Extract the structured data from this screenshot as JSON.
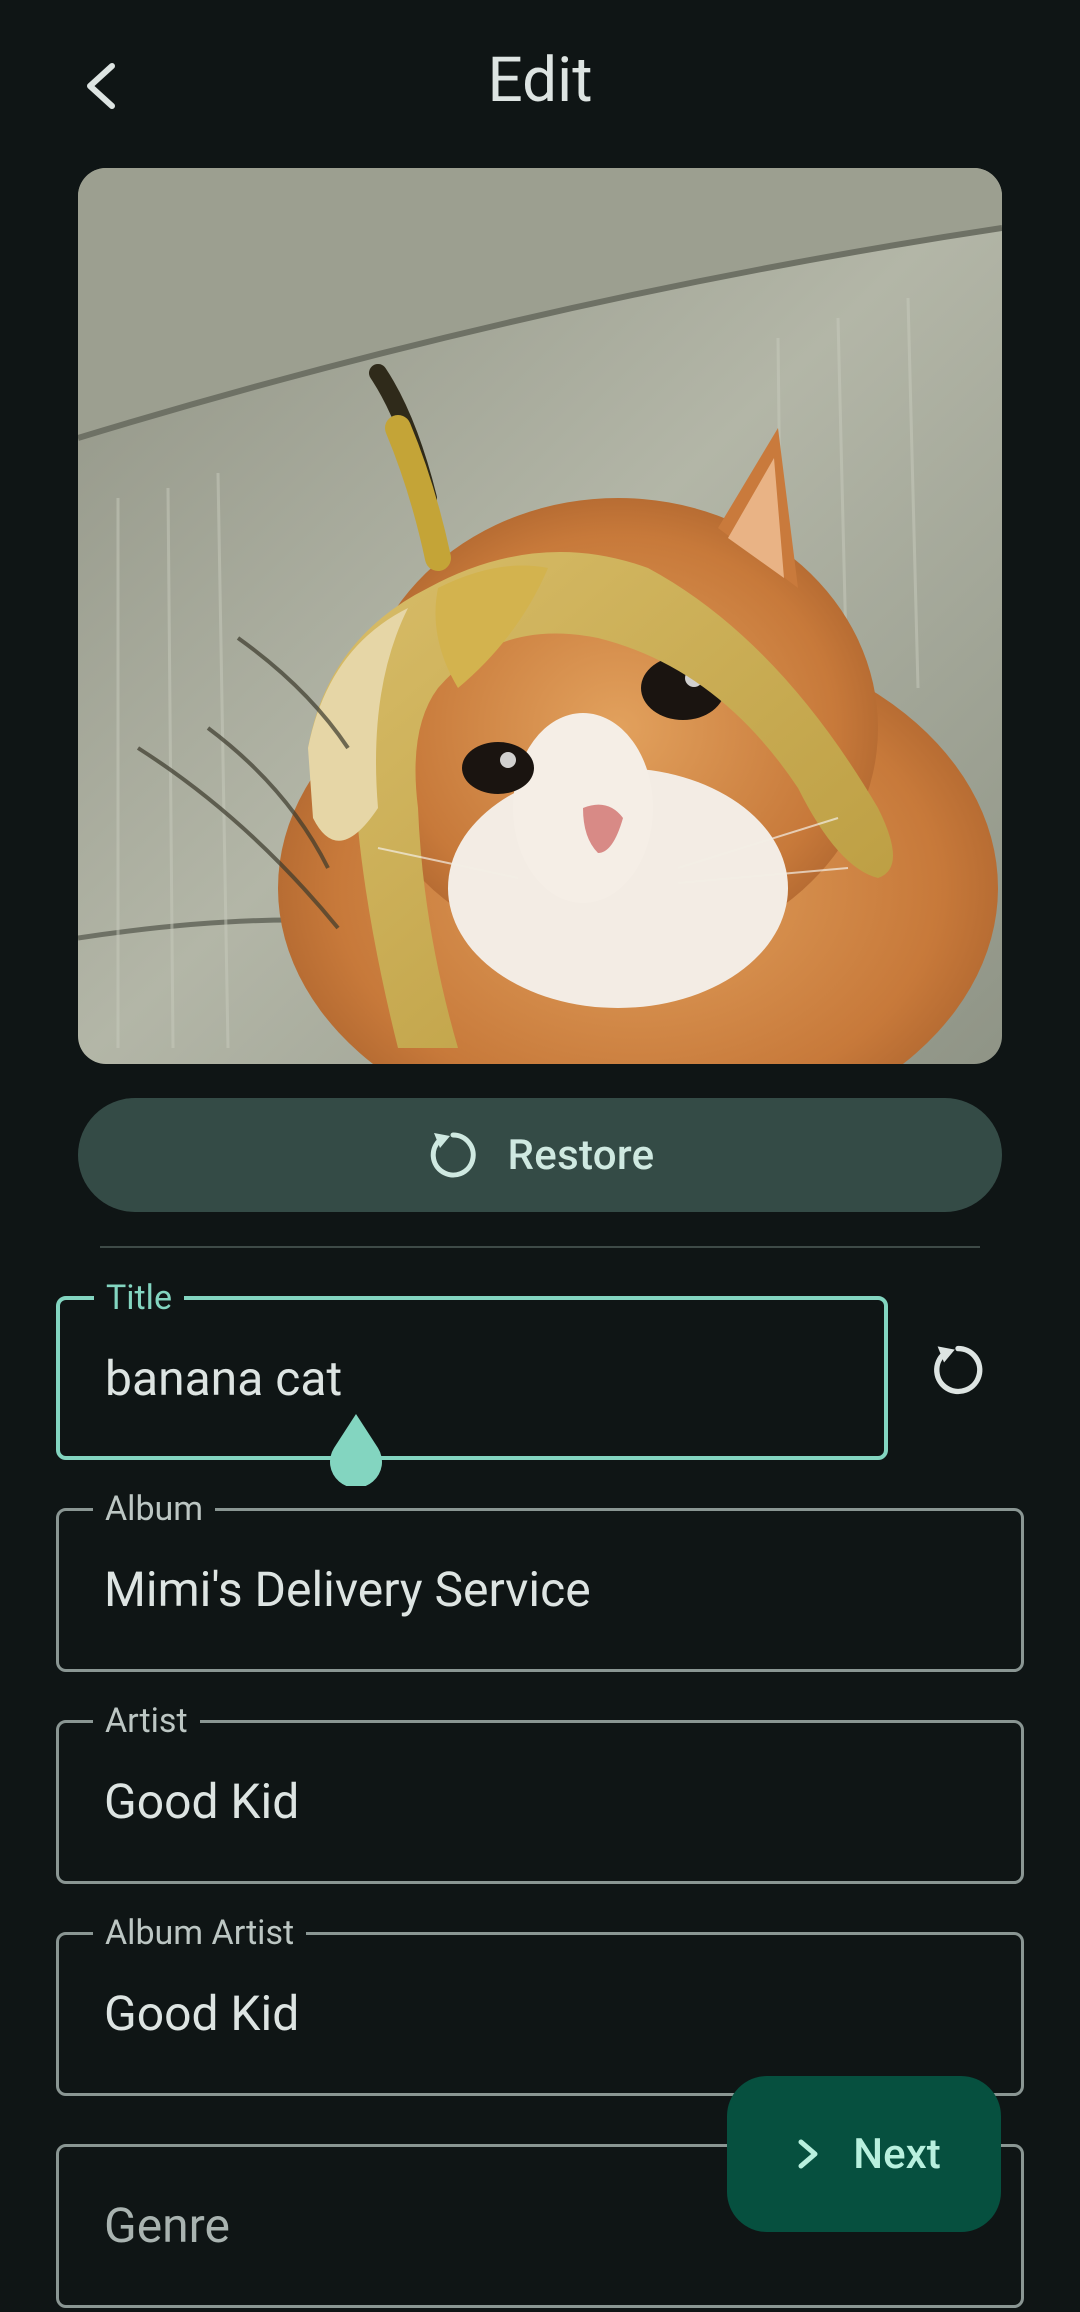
{
  "header": {
    "title": "Edit",
    "back_icon": "arrow-back-icon"
  },
  "artwork": {
    "description_icon": "album-art-image"
  },
  "restore": {
    "label": "Restore",
    "icon": "restore-icon"
  },
  "fields": {
    "title": {
      "label": "Title",
      "value": "banana cat"
    },
    "album": {
      "label": "Album",
      "value": "Mimi's Delivery Service"
    },
    "artist": {
      "label": "Artist",
      "value": "Good Kid"
    },
    "album_artist": {
      "label": "Album Artist",
      "value": "Good Kid"
    },
    "genre": {
      "placeholder": "Genre"
    }
  },
  "fab": {
    "label": "Next",
    "icon": "chevron-right-icon"
  },
  "colors": {
    "background": "#0f1515",
    "accent": "#83d5c0",
    "restore_button": "#344b46",
    "fab": "#06503f"
  }
}
